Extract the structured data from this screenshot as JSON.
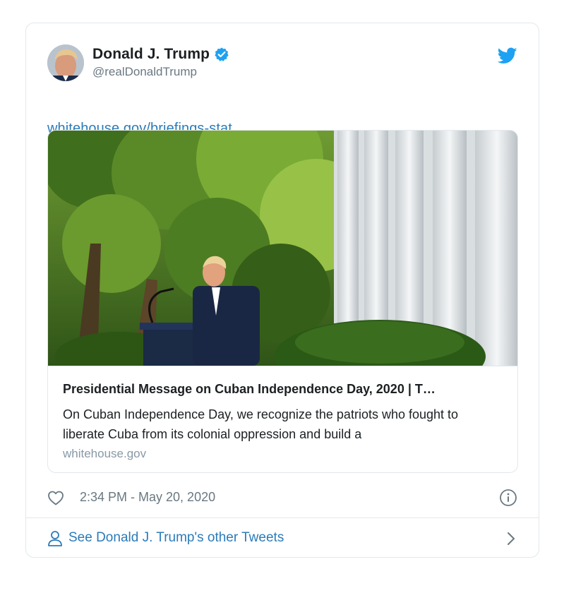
{
  "author": {
    "name": "Donald J. Trump",
    "handle": "@realDonaldTrump",
    "verified": true
  },
  "tweet": {
    "link_text": "whitehouse.gov/briefings-stat…"
  },
  "card": {
    "title": "Presidential Message on Cuban Independence Day, 2020 | T…",
    "description": "On Cuban Independence Day, we recognize the patriots who fought to liberate Cuba from its colonial oppression and build a",
    "domain": "whitehouse.gov"
  },
  "meta": {
    "timestamp": "2:34 PM - May 20, 2020"
  },
  "footer": {
    "label": "See Donald J. Trump's other Tweets"
  },
  "colors": {
    "link": "#2b7bb9",
    "verified": "#1da1f2",
    "muted": "#697882",
    "border": "#e1e8ed"
  },
  "icons": [
    "verified-badge-icon",
    "twitter-bird-icon",
    "heart-icon",
    "info-icon",
    "person-icon",
    "chevron-right-icon"
  ]
}
